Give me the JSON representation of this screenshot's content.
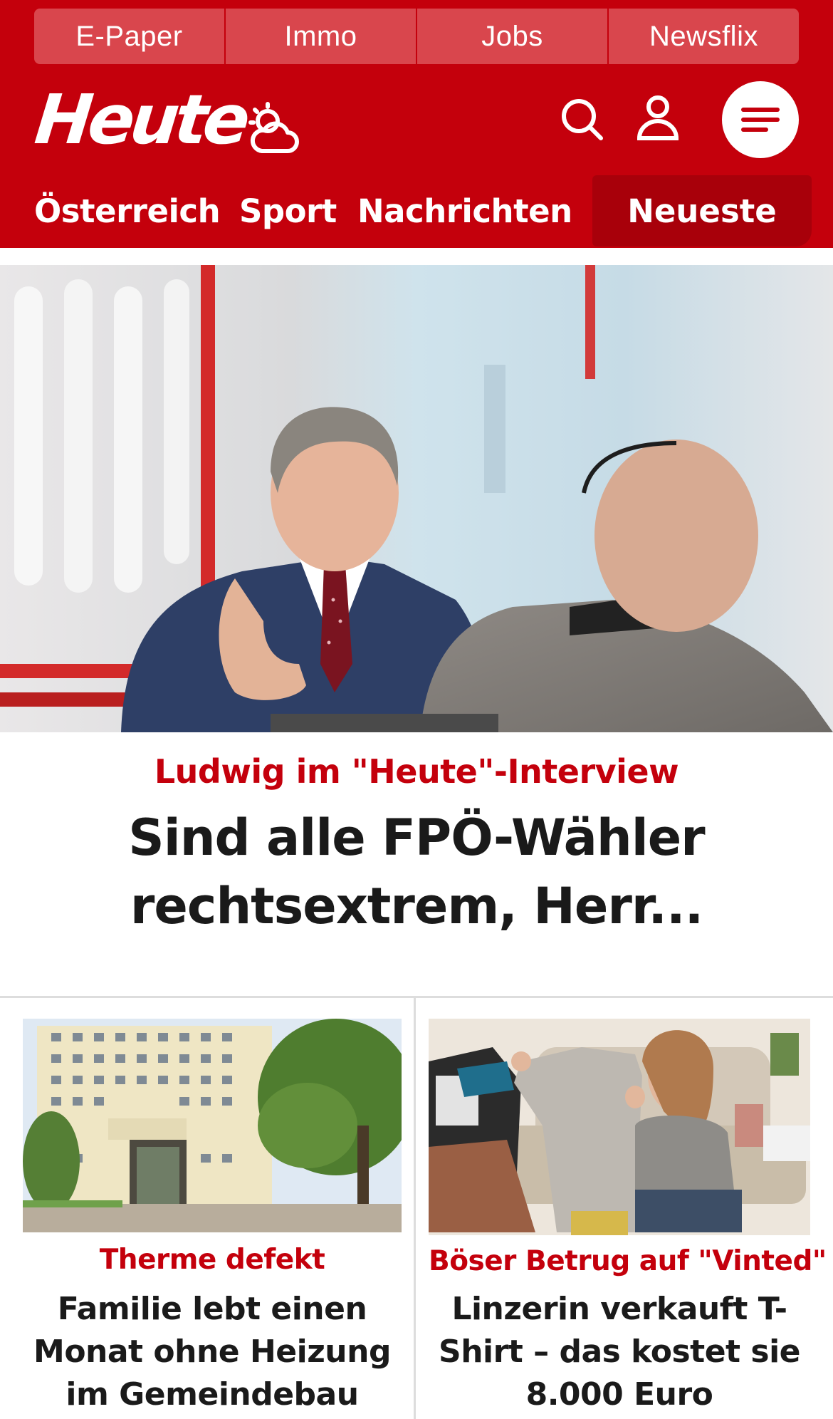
{
  "service_nav": {
    "items": [
      {
        "label": "E-Paper"
      },
      {
        "label": "Immo"
      },
      {
        "label": "Jobs"
      },
      {
        "label": "Newsflix"
      }
    ]
  },
  "header": {
    "logo_text": "Heute",
    "weather_icon": "weather-cloud-sun-icon",
    "search_icon": "search-icon",
    "account_icon": "user-icon",
    "menu_icon": "hamburger-menu-icon"
  },
  "categories": {
    "items": [
      {
        "label": "Österreich"
      },
      {
        "label": "Sport"
      },
      {
        "label": "Nachrichten"
      }
    ],
    "highlight": {
      "label": "Neueste"
    }
  },
  "hero": {
    "kicker": "Ludwig im \"Heute\"-Interview",
    "title": "Sind alle FPÖ-Wähler rechtsextrem, Herr..."
  },
  "teasers": [
    {
      "kicker": "Therme defekt",
      "title": "Familie lebt einen Monat ohne Heizung im Gemeindebau"
    },
    {
      "kicker": "Böser Betrug auf \"Vinted\"",
      "title": "Linzerin verkauft T-Shirt – das kostet sie 8.000 Euro"
    }
  ],
  "colors": {
    "brand_red": "#c4000c",
    "service_bar": "#d9464d",
    "highlight_tab": "#a8000a",
    "text_dark": "#1a1a1a"
  }
}
